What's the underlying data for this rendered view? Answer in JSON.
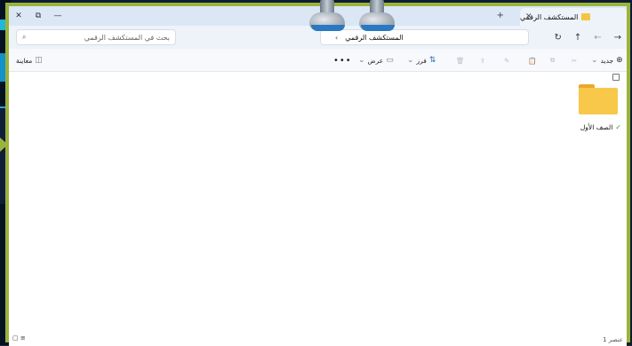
{
  "window": {
    "title": "المستكشف الرقمي",
    "controls": {
      "close": "✕",
      "maximize": "⧉",
      "minimize": "—"
    },
    "new_tab": "+",
    "tab_close": "✕"
  },
  "address_bar": {
    "search_placeholder": "بحث في المستكشف الرقمي",
    "search_icon": "⌕",
    "path": "المستكشف الرقمي",
    "path_chevron": "›",
    "nav": {
      "back": "←",
      "forward": "→",
      "up": "↑",
      "refresh": "↻"
    }
  },
  "toolbar": {
    "new_label": "جديد",
    "new_icon": "⊕",
    "sort_label": "فرز",
    "view_label": "عرض",
    "more": "•••",
    "preview_label": "معاينة",
    "dropdown": "⌄"
  },
  "content": {
    "items": [
      {
        "name": "الصف الأول",
        "status_icon": "✓"
      }
    ]
  },
  "status": {
    "count_text": "1 عنصر",
    "view_icons": "▢ ≡"
  },
  "colors": {
    "frame_border": "#9bb33b",
    "folder": "#f7c84a",
    "title_bg": "#dbe7f5"
  }
}
